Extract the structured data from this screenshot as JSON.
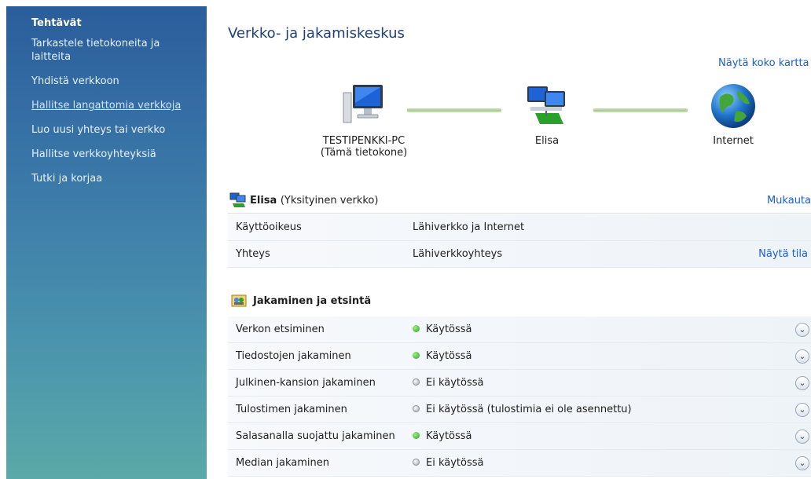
{
  "sidebar": {
    "title": "Tehtävät",
    "items": [
      {
        "label": "Tarkastele tietokoneita ja laitteita"
      },
      {
        "label": "Yhdistä verkkoon"
      },
      {
        "label": "Hallitse langattomia verkkoja"
      },
      {
        "label": "Luo uusi yhteys tai verkko"
      },
      {
        "label": "Hallitse verkkoyhteyksiä"
      },
      {
        "label": "Tutki ja korjaa"
      }
    ]
  },
  "main": {
    "title": "Verkko- ja jakamiskeskus",
    "map_link": "Näytä koko kartta",
    "map": {
      "computer_name": "TESTIPENKKI-PC",
      "computer_sub": "(Tämä tietokone)",
      "network_name": "Elisa",
      "internet_label": "Internet"
    },
    "network": {
      "name": "Elisa",
      "type": "(Yksityinen verkko)",
      "action": "Mukauta",
      "rows": [
        {
          "label": "Käyttöoikeus",
          "value": "Lähiverkko ja Internet",
          "action": ""
        },
        {
          "label": "Yhteys",
          "value": "Lähiverkkoyhteys",
          "action": "Näytä tila"
        }
      ]
    },
    "sharing": {
      "title": "Jakaminen ja etsintä",
      "rows": [
        {
          "label": "Verkon etsiminen",
          "status": "Käytössä",
          "on": true
        },
        {
          "label": "Tiedostojen jakaminen",
          "status": "Käytössä",
          "on": true
        },
        {
          "label": "Julkinen-kansion jakaminen",
          "status": "Ei käytössä",
          "on": false
        },
        {
          "label": "Tulostimen jakaminen",
          "status": "Ei käytössä (tulostimia ei ole asennettu)",
          "on": false
        },
        {
          "label": "Salasanalla suojattu jakaminen",
          "status": "Käytössä",
          "on": true
        },
        {
          "label": "Median jakaminen",
          "status": "Ei käytössä",
          "on": false
        }
      ]
    }
  },
  "icons": [
    "computer-icon",
    "network-icon",
    "globe-icon",
    "sharing-icon",
    "chevron-down-icon"
  ],
  "colors": {
    "accent_link": "#1a5ed0",
    "title": "#1e3f7c",
    "sidebar_top": "#2b5d9c",
    "sidebar_bottom": "#5ba9a8"
  }
}
